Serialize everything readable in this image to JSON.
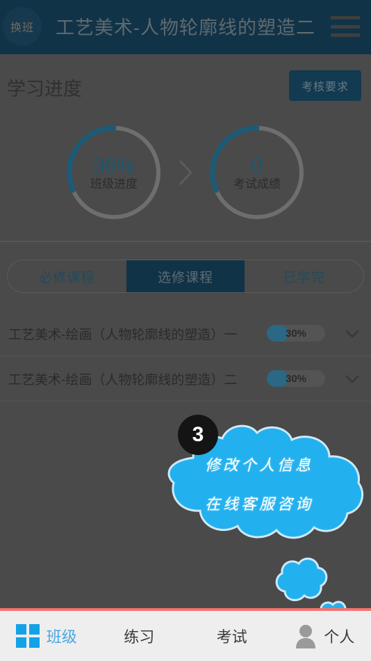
{
  "header": {
    "switch_class_label": "换班",
    "title": "工艺美术-人物轮廓线的塑造二",
    "menu_icon": "hamburger-menu-icon"
  },
  "progress_section": {
    "title": "学习进度",
    "exam_requirement_button": "考核要求",
    "arrow_icon": "chevron-right-icon",
    "metrics": [
      {
        "value": "36%",
        "label": "班级进度",
        "percent": 36
      },
      {
        "value": "0",
        "label": "考试成绩",
        "percent": 36
      }
    ]
  },
  "tabs": [
    {
      "label": "必修课程",
      "active": false
    },
    {
      "label": "选修课程",
      "active": true
    },
    {
      "label": "已学完",
      "active": false
    }
  ],
  "courses": [
    {
      "name": "工艺美术-绘画（人物轮廓线的塑造）一",
      "progress_text": "30%",
      "progress_percent": 30,
      "expand_icon": "chevron-down-icon"
    },
    {
      "name": "工艺美术-绘画（人物轮廓线的塑造）二",
      "progress_text": "30%",
      "progress_percent": 30,
      "expand_icon": "chevron-down-icon"
    }
  ],
  "coachmark": {
    "step_number": "3",
    "line1": "修改个人信息",
    "line2": "在线客服咨询",
    "bubble_color": "#22b1ee",
    "badge_color": "#141414"
  },
  "bottom_nav": [
    {
      "label": "班级",
      "icon": "grid-squares-icon",
      "active": true
    },
    {
      "label": "练习",
      "icon": "",
      "active": false
    },
    {
      "label": "考试",
      "icon": "",
      "active": false
    },
    {
      "label": "个人",
      "icon": "person-icon",
      "active": false
    }
  ],
  "colors": {
    "header_bg": "#113348",
    "accent_blue": "#11a2e8",
    "progress_blue": "#1b5772",
    "nav_top_border": "#f4736f",
    "dim_overlay": "#4a4a4a"
  }
}
